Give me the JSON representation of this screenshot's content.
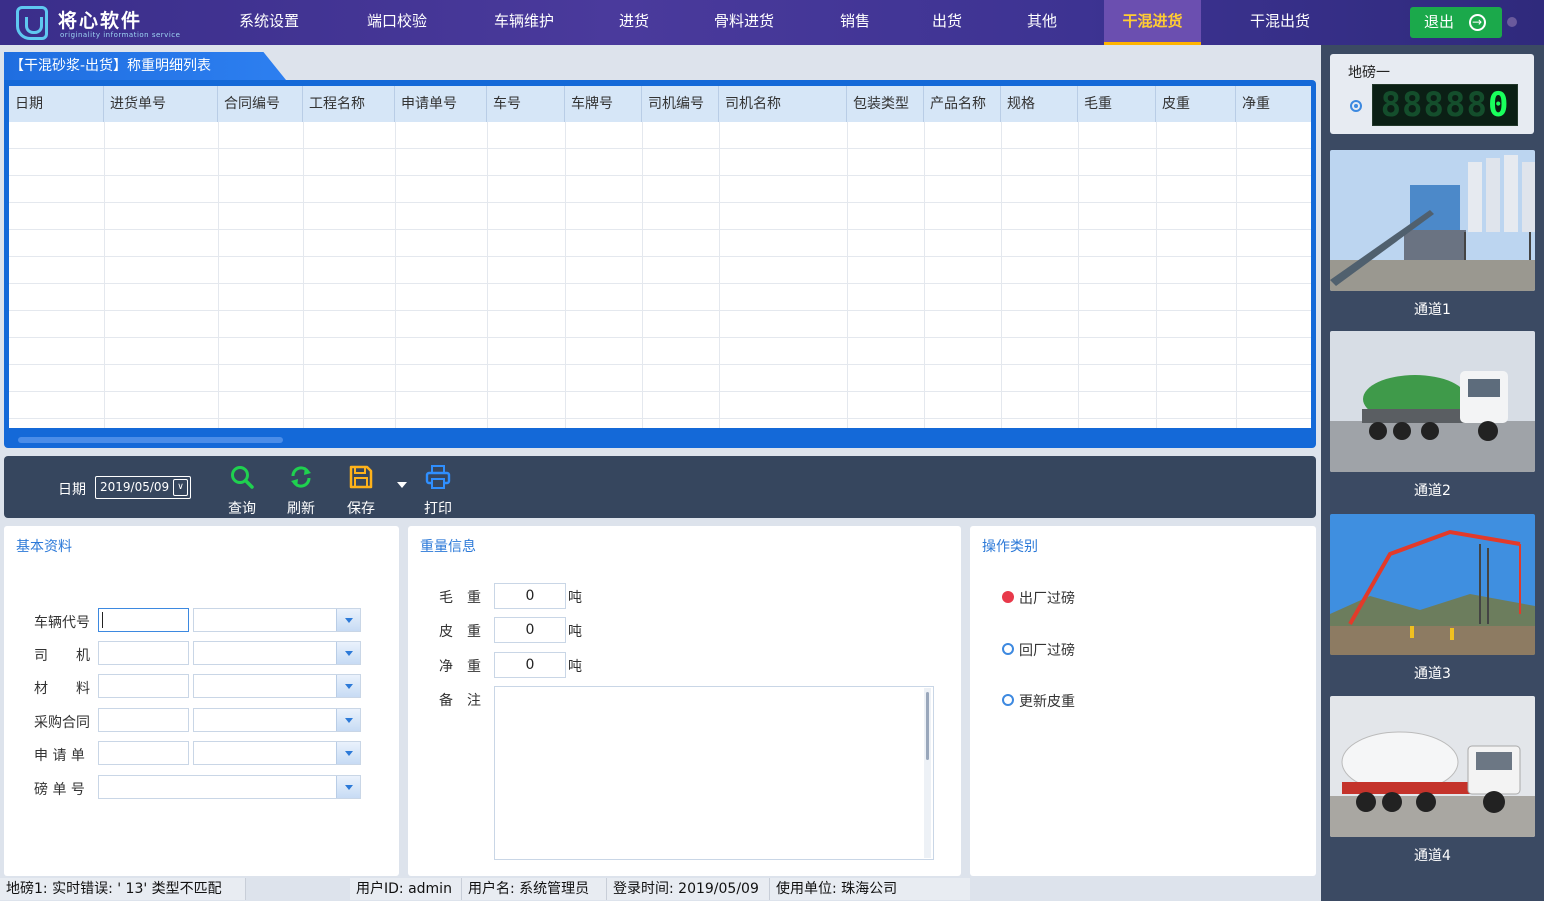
{
  "nav": {
    "logo_text": "将心软件",
    "logo_sub": "originality information service",
    "items": [
      {
        "label": "系统设置"
      },
      {
        "label": "端口校验"
      },
      {
        "label": "车辆维护"
      },
      {
        "label": "进货"
      },
      {
        "label": "骨料进货"
      },
      {
        "label": "销售"
      },
      {
        "label": "出货"
      },
      {
        "label": "其他"
      },
      {
        "label": "干混进货",
        "active": true
      },
      {
        "label": "干混出货"
      }
    ],
    "logout_label": "退出"
  },
  "grid": {
    "title": "【干混砂浆-出货】称重明细列表",
    "columns": [
      "日期",
      "进货单号",
      "合同编号",
      "工程名称",
      "申请单号",
      "车号",
      "车牌号",
      "司机编号",
      "司机名称",
      "包装类型",
      "产品名称",
      "规格",
      "毛重",
      "皮重",
      "净重"
    ],
    "rows": []
  },
  "toolbar": {
    "date_label": "日期",
    "date_value": "2019/05/09",
    "query_label": "查询",
    "refresh_label": "刷新",
    "save_label": "保存",
    "print_label": "打印"
  },
  "basic": {
    "title": "基本资料",
    "vehicle_code_label": "车辆代号",
    "driver_label": "司　　机",
    "material_label": "材　　料",
    "contract_label": "采购合同",
    "request_label": "申 请 单",
    "scale_no_label": "磅 单 号"
  },
  "weight": {
    "title": "重量信息",
    "gross_label": "毛　重",
    "gross_value": "0",
    "tare_label": "皮　重",
    "tare_value": "0",
    "net_label": "净　重",
    "net_value": "0",
    "unit": "吨",
    "remark_label": "备　注",
    "remark_value": ""
  },
  "operation": {
    "title": "操作类别",
    "options": [
      {
        "label": "出厂过磅",
        "checked": true
      },
      {
        "label": "回厂过磅",
        "checked": false
      },
      {
        "label": "更新皮重",
        "checked": false
      }
    ]
  },
  "status": {
    "error": "地磅1: 实时错误: ' 13' 类型不匹配",
    "user_id": "用户ID: admin",
    "user_name": "用户名: 系统管理员",
    "login_time": "登录时间: 2019/05/09",
    "company": "使用单位: 珠海公司"
  },
  "scale": {
    "title": "地磅一",
    "display_bg": "88888",
    "display_value": "0"
  },
  "channels": [
    {
      "label": "通道1"
    },
    {
      "label": "通道2"
    },
    {
      "label": "通道3"
    },
    {
      "label": "通道4"
    }
  ],
  "colors": {
    "accent": "#1f6ee0",
    "nav_bg": "#3a2e8a",
    "active_tab": "#ffcc33",
    "logout": "#1ba94b",
    "toolbar_bg": "#36465e",
    "side_bg": "#3b4a63",
    "checked_radio": "#e8394a"
  }
}
